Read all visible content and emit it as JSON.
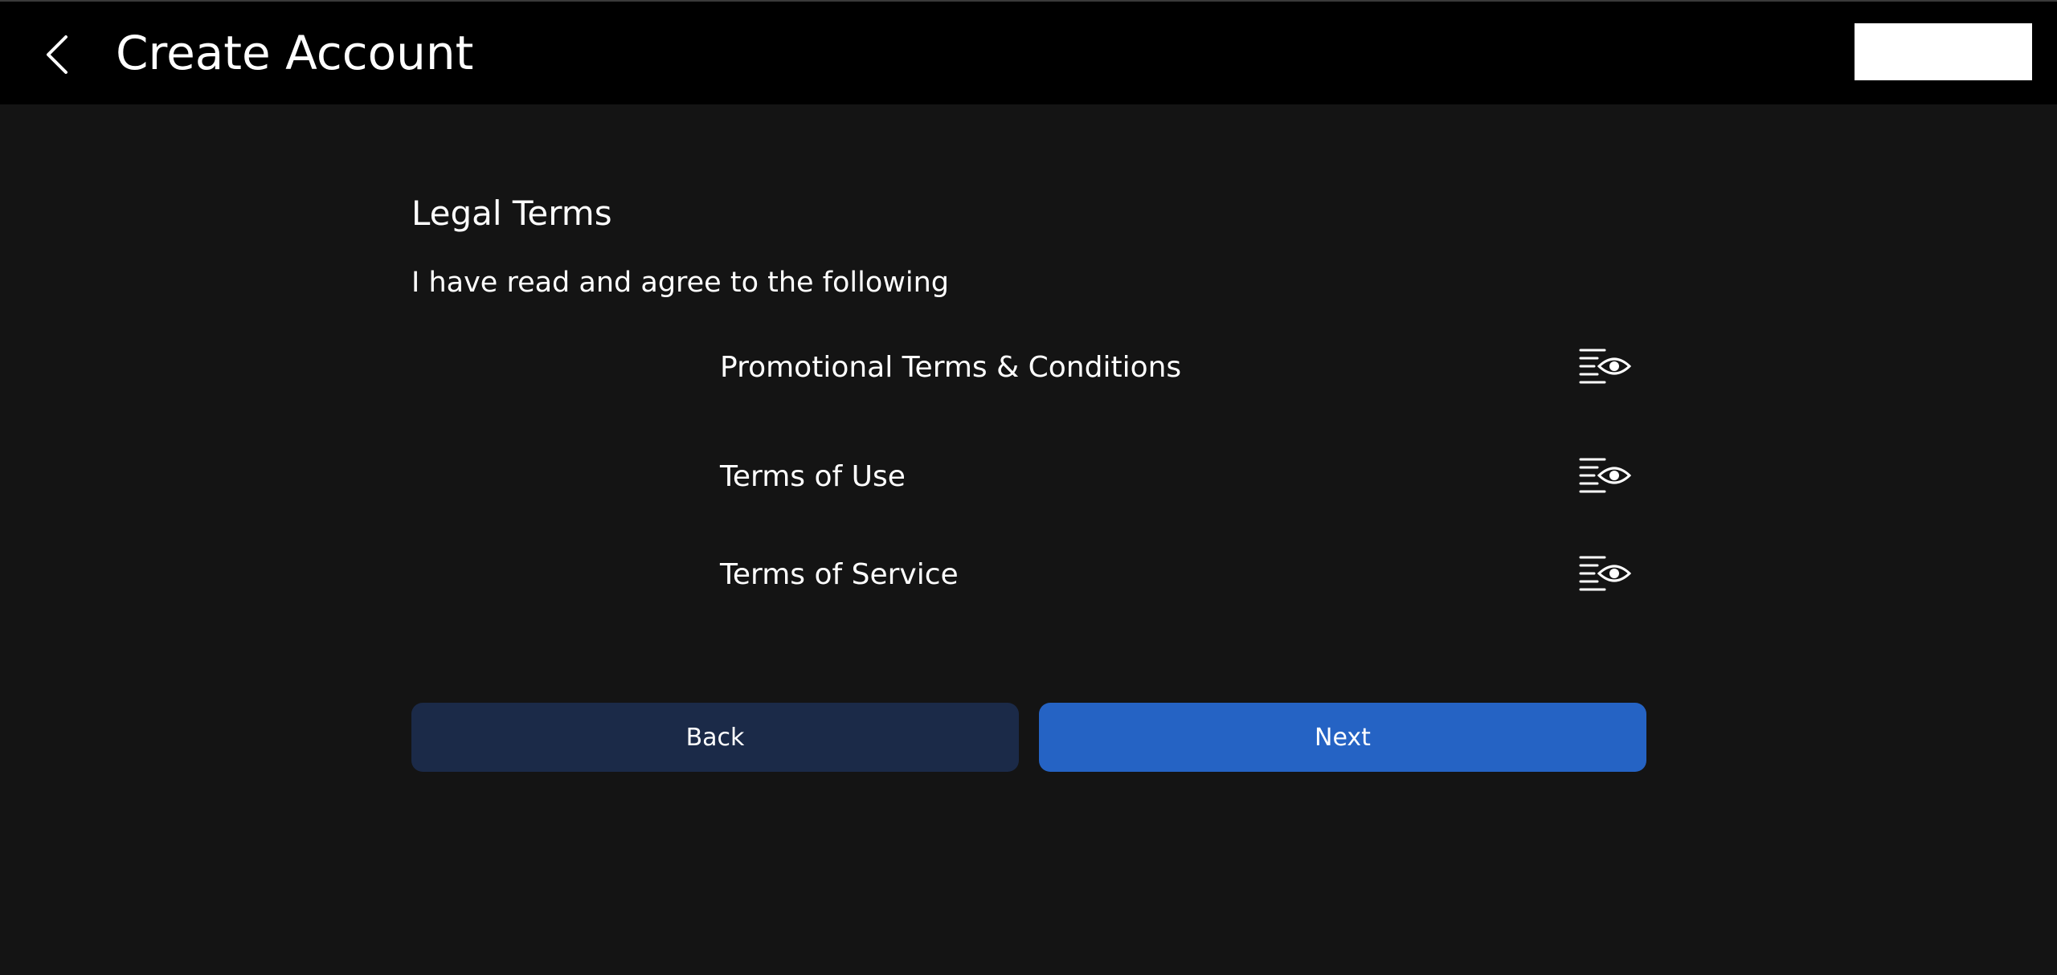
{
  "header": {
    "title": "Create Account",
    "back_icon": "chevron-left-icon"
  },
  "legal": {
    "section_title": "Legal Terms",
    "intro": "I have read and agree to the following",
    "terms": [
      {
        "label": "Promotional Terms & Conditions",
        "icon": "view-document-icon"
      },
      {
        "label": "Terms of Use",
        "icon": "view-document-icon"
      },
      {
        "label": "Terms of Service",
        "icon": "view-document-icon"
      }
    ]
  },
  "actions": {
    "back_label": "Back",
    "next_label": "Next"
  },
  "colors": {
    "background": "#141414",
    "header_background": "#000000",
    "back_button": "#1b2a48",
    "next_button": "#2563c4"
  }
}
